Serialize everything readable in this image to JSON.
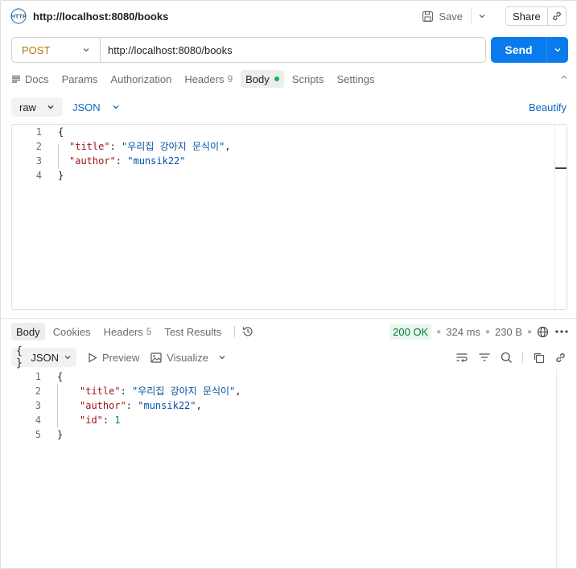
{
  "header": {
    "title": "http://localhost:8080/books",
    "save_label": "Save",
    "share_label": "Share"
  },
  "request": {
    "method": "POST",
    "url": "http://localhost:8080/books",
    "send_label": "Send",
    "tabs": [
      {
        "label": "Docs"
      },
      {
        "label": "Params"
      },
      {
        "label": "Authorization"
      },
      {
        "label": "Headers",
        "count": "9"
      },
      {
        "label": "Body"
      },
      {
        "label": "Scripts"
      },
      {
        "label": "Settings"
      }
    ],
    "body_mode": "raw",
    "body_format": "JSON",
    "beautify_label": "Beautify",
    "line_numbers": [
      "1",
      "2",
      "3",
      "4"
    ],
    "lines": {
      "l1": "{",
      "l2_key": "\"title\"",
      "l2_colon": ": ",
      "l2_val": "\"우리집 강아지 문식이\"",
      "l2_comma": ",",
      "l3_key": "\"author\"",
      "l3_colon": ": ",
      "l3_val": "\"munsik22\"",
      "l4": "}"
    }
  },
  "response": {
    "tabs": [
      {
        "label": "Body"
      },
      {
        "label": "Cookies"
      },
      {
        "label": "Headers",
        "count": "5"
      },
      {
        "label": "Test Results"
      }
    ],
    "status": "200 OK",
    "time": "324 ms",
    "size": "230 B",
    "format": "JSON",
    "preview_label": "Preview",
    "visualize_label": "Visualize",
    "line_numbers": [
      "1",
      "2",
      "3",
      "4",
      "5"
    ],
    "lines": {
      "l1": "{",
      "l2_key": "\"title\"",
      "l2_colon": ": ",
      "l2_val": "\"우리집 강아지 문식이\"",
      "l2_comma": ",",
      "l3_key": "\"author\"",
      "l3_colon": ": ",
      "l3_val": "\"munsik22\"",
      "l3_comma": ",",
      "l4_key": "\"id\"",
      "l4_colon": ": ",
      "l4_val": "1",
      "l5": "}"
    }
  },
  "colors": {
    "send": "#097bed",
    "method": "#ad7a03",
    "status_ok": "#067a3c",
    "body_dot": "#0cbb52",
    "link": "#0a66c2"
  },
  "icons": [
    "http-icon",
    "save-icon",
    "chevron-down-icon",
    "link-icon",
    "docs-icon",
    "collapse-icon",
    "history-icon",
    "globe-icon",
    "more-icon",
    "braces-icon",
    "play-icon",
    "image-icon",
    "wrap-icon",
    "filter-icon",
    "search-icon",
    "copy-icon"
  ]
}
